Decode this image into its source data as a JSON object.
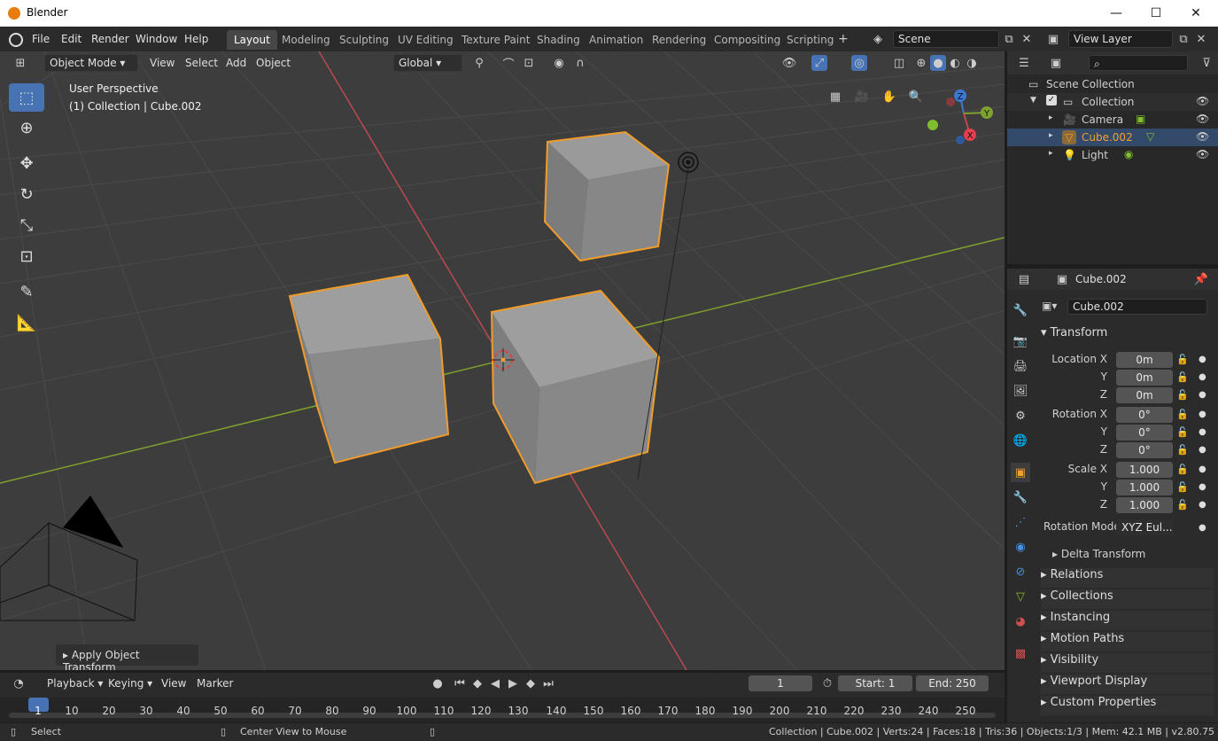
{
  "window": {
    "title": "Blender"
  },
  "menu": [
    "File",
    "Edit",
    "Render",
    "Window",
    "Help"
  ],
  "workspaces": [
    "Layout",
    "Modeling",
    "Sculpting",
    "UV Editing",
    "Texture Paint",
    "Shading",
    "Animation",
    "Rendering",
    "Compositing",
    "Scripting"
  ],
  "scene": {
    "name": "Scene",
    "view_layer": "View Layer"
  },
  "viewport_header": {
    "mode": "Object Mode",
    "view": "View",
    "select": "Select",
    "add": "Add",
    "object": "Object",
    "orientation": "Global"
  },
  "viewport": {
    "perspective": "User Perspective",
    "collection_info": "(1) Collection | Cube.002",
    "operator_panel": "Apply Object Transform"
  },
  "outliner": {
    "root": "Scene Collection",
    "items": [
      {
        "name": "Collection"
      },
      {
        "name": "Camera"
      },
      {
        "name": "Cube.002",
        "selected": true
      },
      {
        "name": "Light"
      }
    ]
  },
  "properties": {
    "object_name": "Cube.002",
    "data_name": "Cube.002",
    "transform_label": "Transform",
    "location": {
      "label": "Location X",
      "x": "0m",
      "y": "0m",
      "z": "0m"
    },
    "rotation": {
      "label": "Rotation X",
      "x": "0°",
      "y": "0°",
      "z": "0°"
    },
    "scale": {
      "label": "Scale X",
      "x": "1.000",
      "y": "1.000",
      "z": "1.000"
    },
    "axis_y": "Y",
    "axis_z": "Z",
    "rotation_mode_label": "Rotation Mode",
    "rotation_mode": "XYZ Eul...",
    "delta": "Delta Transform",
    "sections": [
      "Relations",
      "Collections",
      "Instancing",
      "Motion Paths",
      "Visibility",
      "Viewport Display",
      "Custom Properties"
    ]
  },
  "timeline": {
    "playback": "Playback",
    "keying": "Keying",
    "view": "View",
    "marker": "Marker",
    "current_frame": "1",
    "start_label": "Start:",
    "start": "1",
    "end_label": "End:",
    "end": "250",
    "ticks": [
      "1",
      "10",
      "20",
      "30",
      "40",
      "50",
      "60",
      "70",
      "80",
      "90",
      "100",
      "110",
      "120",
      "130",
      "140",
      "150",
      "160",
      "170",
      "180",
      "190",
      "200",
      "210",
      "220",
      "230",
      "240",
      "250"
    ]
  },
  "status": {
    "select": "Select",
    "center": "Center View to Mouse",
    "info": "Collection | Cube.002 | Verts:24 | Faces:18 | Tris:36 | Objects:1/3 | Mem: 42.1 MB | v2.80.75"
  },
  "colors": {
    "accent": "#4772b3",
    "selection": "#f09c2a",
    "x_axis": "#c2484f",
    "y_axis": "#7fa12d",
    "z_axis": "#3b78d6"
  }
}
